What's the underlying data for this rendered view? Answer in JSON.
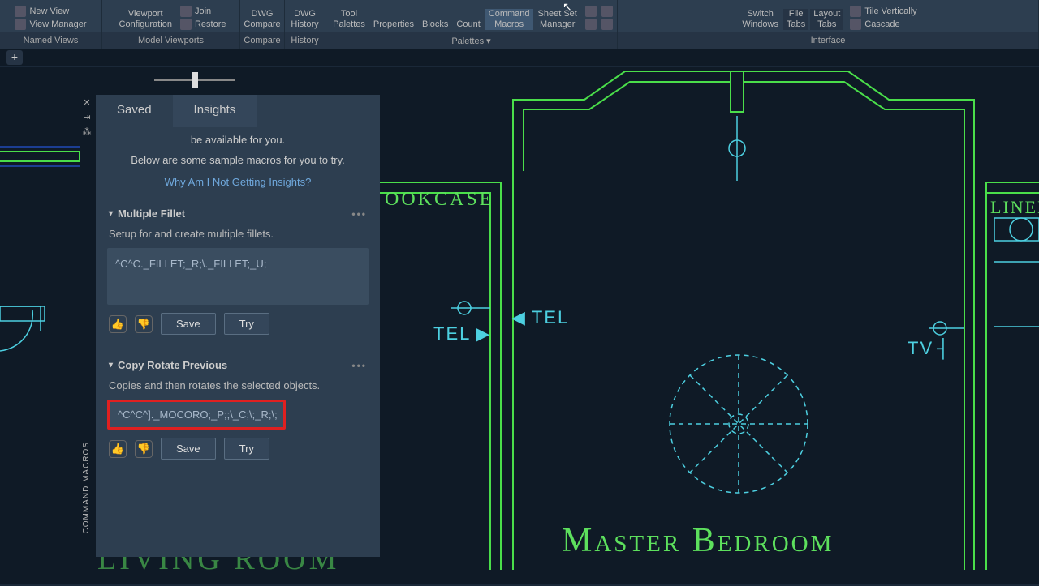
{
  "ribbon": {
    "newView": "New View",
    "viewManager": "View Manager",
    "viewportConfig": "Viewport\nConfiguration",
    "join": "Join",
    "restore": "Restore",
    "dwgCompare": "DWG\nCompare",
    "dwgHistory": "DWG\nHistory",
    "toolPalettes": "Tool\nPalettes",
    "properties": "Properties",
    "blocks": "Blocks",
    "count": "Count",
    "commandMacros": "Command\nMacros",
    "sheetSet": "Sheet Set\nManager",
    "switchWindows": "Switch\nWindows",
    "fileTabs": "File\nTabs",
    "layoutTabs": "Layout\nTabs",
    "tileVertically": "Tile Vertically",
    "cascade": "Cascade"
  },
  "sections": {
    "namedViews": "Named Views",
    "modelViewports": "Model Viewports",
    "compare": "Compare",
    "history": "History",
    "palettes": "Palettes ▾",
    "interface": "Interface"
  },
  "panel": {
    "verticalLabel": "COMMAND MACROS",
    "tabs": {
      "saved": "Saved",
      "insights": "Insights"
    },
    "intro1": "be available for you.",
    "intro2": "Below are some sample macros for you to try.",
    "link": "Why Am I Not Getting Insights?",
    "macros": [
      {
        "title": "Multiple Fillet",
        "desc": "Setup for and create multiple fillets.",
        "code": "^C^C._FILLET;_R;\\._FILLET;_U;",
        "highlight": false
      },
      {
        "title": "Copy Rotate Previous",
        "desc": "Copies and then rotates the selected objects.",
        "code": "^C^C^]._MOCORO;_P;;\\_C;\\;_R;\\;",
        "highlight": true
      }
    ],
    "buttons": {
      "save": "Save",
      "try": "Try"
    }
  },
  "drawing": {
    "bookcase": "OOKCASE",
    "tel1": "TEL",
    "tel2": "TEL",
    "tv": "TV",
    "liner": "LINEN",
    "masterBedroom": "Master Bedroom",
    "livingRoom": "LIVING ROOM"
  },
  "colors": {
    "wall": "#4ade4a",
    "furniture": "#4dd0e1",
    "text_cyan": "#4dd0e1",
    "text_green": "#5de05d",
    "dim": "#0066ff"
  }
}
